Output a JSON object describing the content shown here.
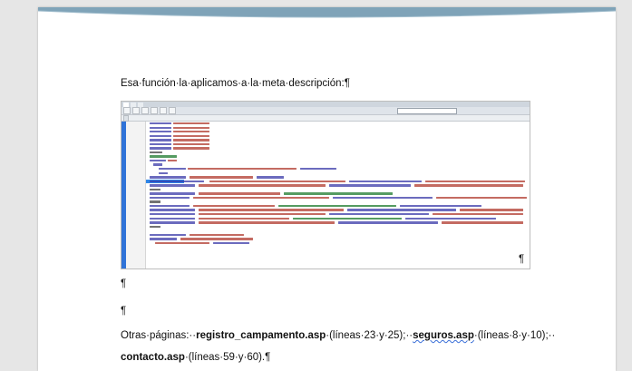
{
  "document": {
    "paragraph_1": "Esa·función·la·aplicamos·a·la·meta·descripción:¶",
    "screenshot_pilcrow": "¶",
    "empty_pilcrow_1": "¶",
    "empty_pilcrow_2": "¶",
    "paragraph_2": {
      "part_a": "Otras·páginas:··",
      "file_1": "registro_campamento.asp",
      "part_b": "·(líneas·23·y·25);··",
      "file_2": "seguros.asp",
      "part_c": "·(líneas·8·y·10);··",
      "file_3": "contacto.asp",
      "part_d": "·(líneas·59·y·60).¶"
    }
  },
  "colors": {
    "header_band": "#7fa3b8",
    "page": "#ffffff",
    "background": "#e6e6e6",
    "editor_accent": "#2f73d8"
  }
}
